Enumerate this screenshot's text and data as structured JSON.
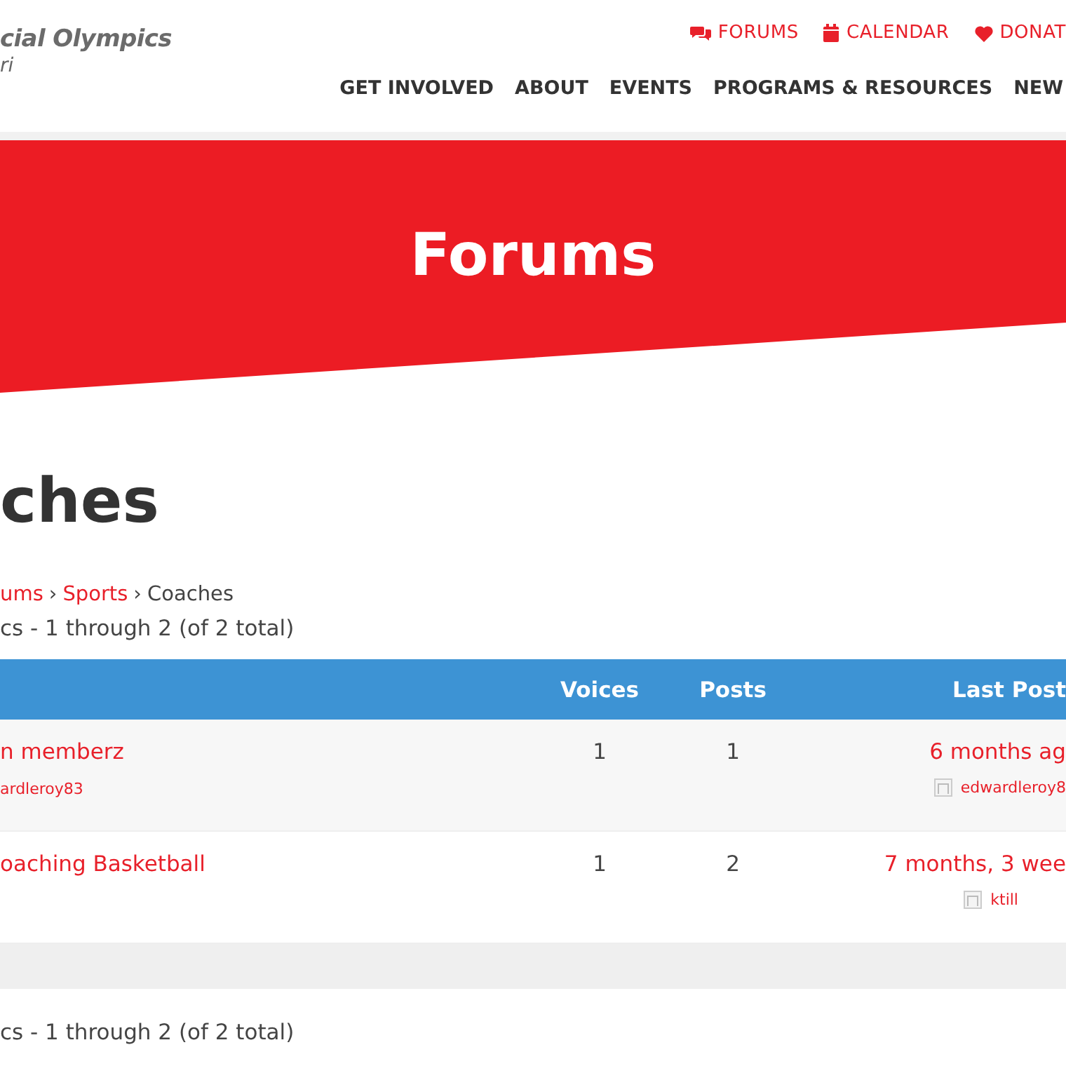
{
  "header": {
    "logo_text": "cial Olympics",
    "logo_subtext": "ri",
    "top_links": [
      {
        "kind": "forums",
        "label": "FORUMS"
      },
      {
        "kind": "calendar",
        "label": "CALENDAR"
      },
      {
        "kind": "donate",
        "label": "DONAT"
      }
    ],
    "nav": [
      "GET INVOLVED",
      "ABOUT",
      "EVENTS",
      "PROGRAMS & RESOURCES",
      "NEW"
    ]
  },
  "banner": {
    "title": "Forums"
  },
  "forum": {
    "title": "ches",
    "breadcrumbs": [
      {
        "kind": "link",
        "label": "ums"
      },
      {
        "kind": "separator",
        "label": "›"
      },
      {
        "kind": "link",
        "label": "Sports"
      },
      {
        "kind": "separator",
        "label": "›"
      },
      {
        "kind": "current",
        "label": "Coaches"
      }
    ],
    "count_top": "cs - 1 through 2 (of 2 total)",
    "columns": [
      "Voices",
      "Posts",
      "Last Post"
    ],
    "rows": [
      {
        "title": "n memberz",
        "starter": "ardleroy83",
        "voices": "1",
        "posts": "1",
        "last_post": "6 months ag",
        "last_author": "edwardleroy8"
      },
      {
        "title": "oaching Basketball",
        "voices": "1",
        "posts": "2",
        "last_post": "7 months, 3 wee",
        "last_author": "ktill"
      }
    ],
    "count_bottom": "cs - 1 through 2 (of 2 total)"
  }
}
